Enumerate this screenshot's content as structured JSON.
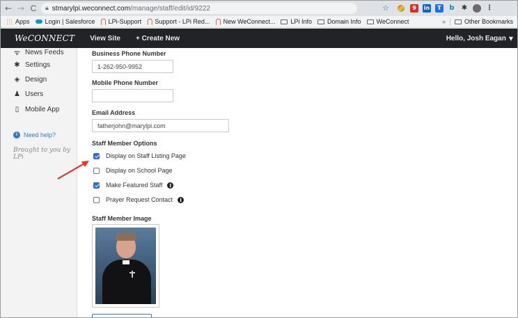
{
  "browser": {
    "url_host": "stmarylpi.weconnect.com",
    "url_path": "/manage/staff/edit/id/9222",
    "nav": {
      "back": "←",
      "forward": "→",
      "reload": "C",
      "home": "⌂"
    },
    "star_icon": "bookmark-star-icon"
  },
  "bookmarks": {
    "items": [
      "Apps",
      "Login | Salesforce",
      "LPi-Support",
      "Support - LPi Red...",
      "New WeConnect...",
      "LPi Info",
      "Domain Info",
      "WeConnect"
    ],
    "overflow": "»",
    "other": "Other Bookmarks"
  },
  "header": {
    "logo": "WeCONNECT",
    "view_site": "View Site",
    "create_new": "+ Create New",
    "greeting": "Hello, Josh Eagan"
  },
  "sidebar": {
    "items": [
      {
        "label": "News Feeds",
        "icon": "rss-icon"
      },
      {
        "label": "Settings",
        "icon": "gear-icon"
      },
      {
        "label": "Design",
        "icon": "paint-bucket-icon"
      },
      {
        "label": "Users",
        "icon": "users-icon"
      },
      {
        "label": "Mobile App",
        "icon": "mobile-icon"
      }
    ],
    "help": "Need help?",
    "brought_by": "Brought to you by LPi"
  },
  "form": {
    "business_phone_label": "Business Phone Number",
    "business_phone_value": "1-262-950-9952",
    "mobile_phone_label": "Mobile Phone Number",
    "mobile_phone_value": "",
    "email_label": "Email Address",
    "email_value": "fatherjohn@marylpi.com",
    "options_label": "Staff Member Options",
    "options": [
      {
        "label": "Display on Staff Listing Page",
        "checked": true,
        "info": false
      },
      {
        "label": "Display on School Page",
        "checked": false,
        "info": false
      },
      {
        "label": "Make Featured Staff",
        "checked": true,
        "info": true
      },
      {
        "label": "Prayer Request Contact",
        "checked": false,
        "info": true
      }
    ],
    "image_label": "Staff Member Image"
  },
  "colors": {
    "header_bg": "#222326",
    "accent_blue": "#2e6fd6",
    "annotation_arrow": "#e5362b"
  }
}
